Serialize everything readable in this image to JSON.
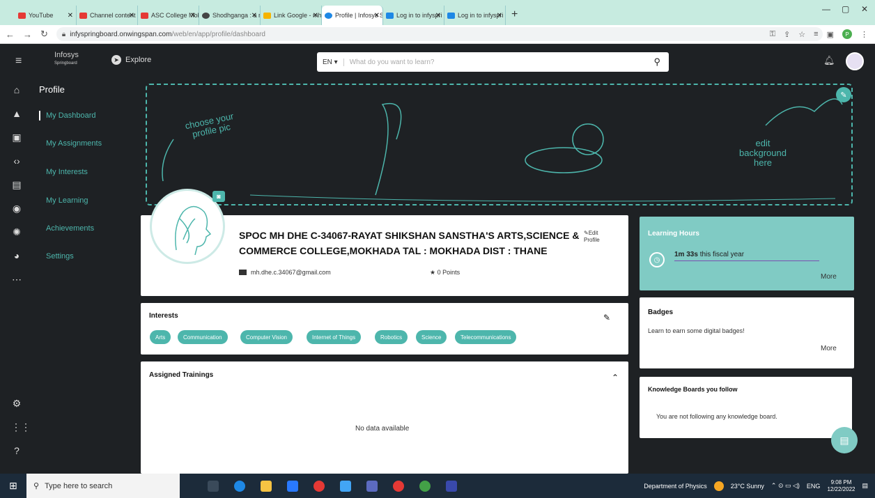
{
  "browser": {
    "tabs": [
      {
        "label": "YouTube",
        "color": "#e53935"
      },
      {
        "label": "Channel content -",
        "color": "#e53935"
      },
      {
        "label": "ASC College Mok",
        "color": "#e53935"
      },
      {
        "label": "Shodhganga : a re",
        "color": "#444444"
      },
      {
        "label": "Link Google - mh",
        "color": "#f6b400"
      },
      {
        "label": "Profile | Infosys Sp",
        "color": "#1e88e5",
        "active": true
      },
      {
        "label": "Log in to infyspri",
        "color": "#1e88e5"
      },
      {
        "label": "Log in to infyspri",
        "color": "#1e88e5"
      }
    ],
    "new_tab": "+",
    "url_host": "infyspringboard.onwingspan.com",
    "url_path": "/web/en/app/profile/dashboard",
    "win_minimize": "—",
    "win_restore": "▢",
    "win_close": "✕",
    "profile_initial": "P"
  },
  "app": {
    "logo_line1": "Infosys",
    "logo_line2": "Springboard",
    "explore": "Explore",
    "search_lang": "EN ▾",
    "search_placeholder": "What do you want to learn?",
    "sidebar": {
      "title": "Profile",
      "items": [
        "My Dashboard",
        "My Assignments",
        "My Interests",
        "My Learning",
        "Achievements",
        "Settings"
      ]
    },
    "banner": {
      "choose_pic": "choose your profile pic",
      "edit_bg_1": "edit",
      "edit_bg_2": "background",
      "edit_bg_3": "here"
    },
    "profile": {
      "name": "SPOC MH DHE C-34067-RAYAT SHIKSHAN SANSTHA'S ARTS,SCIENCE & COMMERCE COLLEGE,MOKHADA TAL : MOKHADA DIST : THANE",
      "edit_1": "Edit",
      "edit_2": "Profile",
      "email": "mh.dhe.c.34067@gmail.com",
      "points": "0 Points"
    },
    "interests": {
      "title": "Interests",
      "chips": [
        "Arts",
        "Communication",
        "Computer Vision",
        "Internet of Things",
        "Robotics",
        "Science",
        "Telecommunications"
      ]
    },
    "assigned": {
      "title": "Assigned Trainings",
      "empty": "No data available"
    },
    "learning_hours": {
      "title": "Learning Hours",
      "value": "1m 33s",
      "suffix": "this fiscal year",
      "more": "More"
    },
    "badges": {
      "title": "Badges",
      "text": "Learn to earn some digital badges!",
      "more": "More"
    },
    "knowledge": {
      "title": "Knowledge Boards you follow",
      "text": "You are not following any knowledge board."
    }
  },
  "taskbar": {
    "search_placeholder": "Type here to search",
    "dept": "Department of Physics",
    "weather": "23°C  Sunny",
    "lang": "ENG",
    "time": "9:08 PM",
    "date": "12/22/2022"
  },
  "colors": {
    "accent": "#4db6ac",
    "dark_bg": "#1e2124",
    "tab_bg": "#c7ebe0"
  }
}
